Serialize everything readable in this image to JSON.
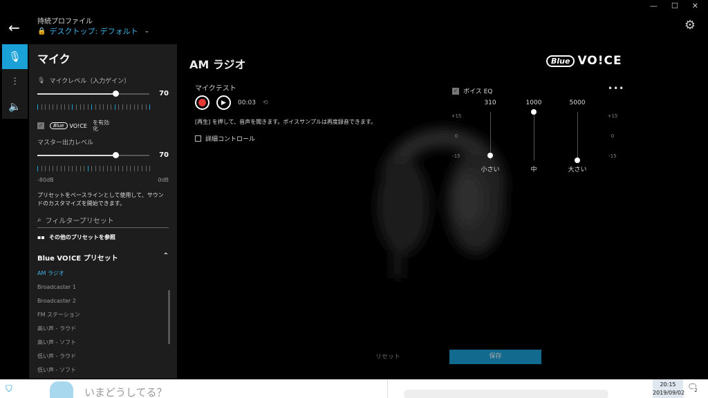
{
  "window": {
    "minimize_icon": "minimize-icon",
    "maximize_icon": "maximize-icon",
    "close_icon": "close-icon",
    "minimize_glyph": "—",
    "maximize_glyph": "☐",
    "close_glyph": "✕",
    "settings_glyph": "⚙"
  },
  "header": {
    "back_glyph": "←",
    "profile_label": "持続プロファイル",
    "profile_value": "デスクトップ: デフォルト",
    "lock_glyph": "🔒",
    "chevron_glyph": "⌄"
  },
  "rail": {
    "mic_glyph": "🎙",
    "eq_glyph": "⫶",
    "speaker_glyph": "🔈"
  },
  "panel": {
    "title": "マイク",
    "mic_level_label": "マイクレベル（入力ゲイン）",
    "mic_level_value": "70",
    "mic_level_fraction": 0.7,
    "blue_voice_logo_blue": "Blue",
    "blue_voice_logo_voice": "VO!CE",
    "blue_voice_enable": "を有効化",
    "master_level_label": "マスター出力レベル",
    "master_level_value": "70",
    "master_level_fraction": 0.7,
    "db_min": "-80dB",
    "db_max": "0dB",
    "description": "プリセットをベースラインとして使用して、サウンドのカスタマイズを開始できます。",
    "filter_placeholder": "フィルタープリセット",
    "browse_label": "その他のプリセットを参照",
    "preset_header": "Blue VO!CE プリセット",
    "preset_chevron": "⌃",
    "presets": [
      "AM ラジオ",
      "Broadcaster 1",
      "Broadcaster 2",
      "FM ステーション",
      "高い声 - ラウド",
      "高い声 - ソフト",
      "低い声 - ラウド",
      "低い声 - ソフト"
    ]
  },
  "main": {
    "title": "AM ラジオ",
    "logo_blue": "Blue",
    "logo_voice": "VO!CE",
    "mic_test_label": "マイクテスト",
    "play_glyph": "▶",
    "time": "00:03",
    "loop_glyph": "⟲",
    "hint": "[再生] を押して、音声を聞きます。ボイスサンプルは再度録音できます。",
    "advanced_label": "詳細コントロール",
    "reset_label": "リセット",
    "save_label": "保存"
  },
  "eq": {
    "title": "ボイス EQ",
    "more_glyph": "•••",
    "scale_top": "+15",
    "scale_mid": "0",
    "scale_bottom": "-15",
    "bands": [
      {
        "freq": "310",
        "label": "小さい",
        "gain": -12
      },
      {
        "freq": "1000",
        "label": "中",
        "gain": 15
      },
      {
        "freq": "5000",
        "label": "大さい",
        "gain": -15
      }
    ]
  },
  "taskbar": {
    "shield_glyph": "⛉",
    "tweet_placeholder": "いまどうしてる？",
    "clock_time": "20:15",
    "clock_date": "2019/09/02",
    "notify_glyph": "🗨",
    "notify_count": "2"
  }
}
